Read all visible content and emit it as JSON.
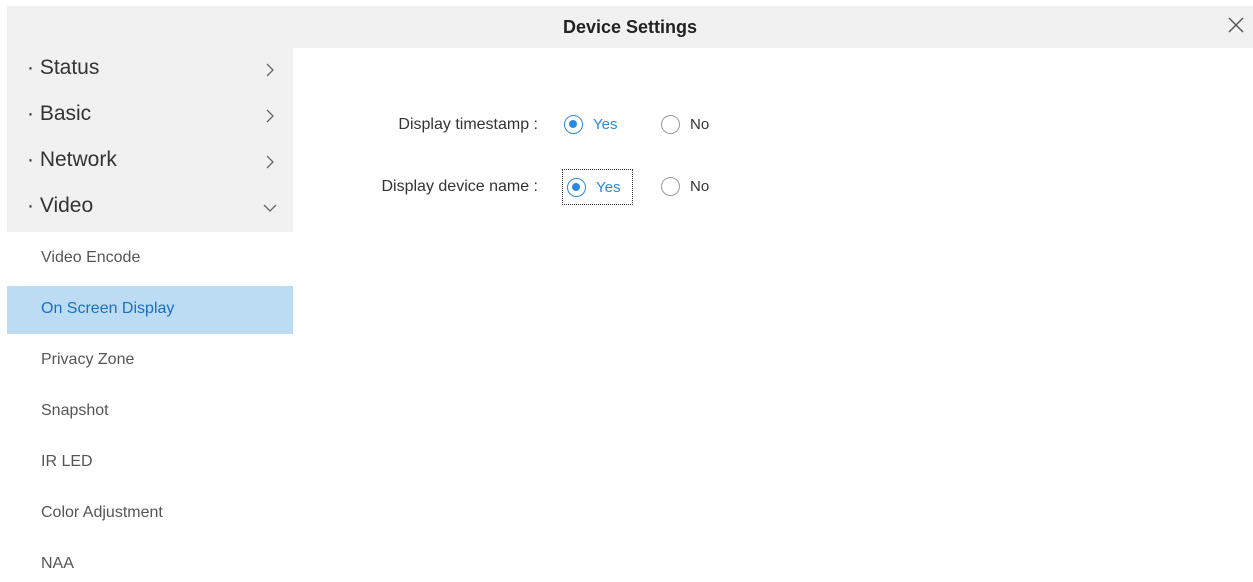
{
  "window": {
    "title": "Device Settings",
    "close_icon": "close-icon"
  },
  "sidebar": {
    "sections": [
      {
        "label": "· Status",
        "expanded": false
      },
      {
        "label": "· Basic",
        "expanded": false
      },
      {
        "label": "· Network",
        "expanded": false
      },
      {
        "label": "· Video",
        "expanded": true
      }
    ],
    "subitems": [
      {
        "label": "Video Encode",
        "active": false
      },
      {
        "label": "On Screen Display",
        "active": true
      },
      {
        "label": "Privacy Zone",
        "active": false
      },
      {
        "label": "Snapshot",
        "active": false
      },
      {
        "label": "IR LED",
        "active": false
      },
      {
        "label": "Color Adjustment",
        "active": false
      },
      {
        "label": "NAA",
        "active": false
      }
    ]
  },
  "settings": {
    "timestamp": {
      "label": "Display timestamp :",
      "yes": "Yes",
      "no": "No",
      "selected": "Yes"
    },
    "device_name": {
      "label": "Display device name :",
      "yes": "Yes",
      "no": "No",
      "selected": "Yes"
    }
  },
  "colors": {
    "accent": "#2a8ae0",
    "active_bg": "#bcdcf4",
    "header_bg": "#f1f1f1"
  }
}
